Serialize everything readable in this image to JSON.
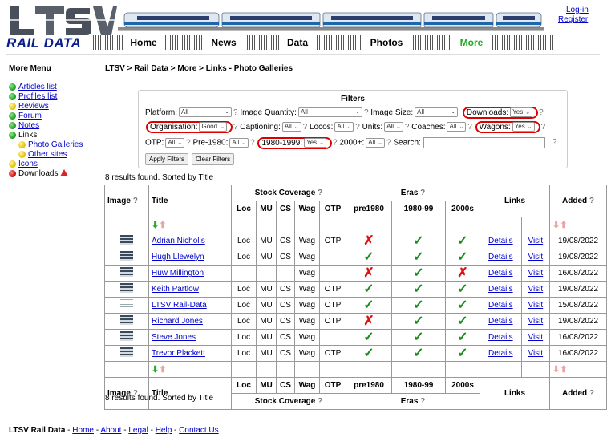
{
  "header": {
    "logo_text": "LTSV",
    "subtitle": "RAIL DATA",
    "nav": [
      "Home",
      "News",
      "Data",
      "Photos",
      "More"
    ],
    "active_nav": "More",
    "login": "Log-in",
    "register": "Register"
  },
  "sidebar": {
    "title": "More Menu",
    "items": [
      {
        "label": "Articles list",
        "color": "green",
        "link": true
      },
      {
        "label": "Profiles list",
        "color": "green",
        "link": true
      },
      {
        "label": "Reviews",
        "color": "yellow",
        "link": true
      },
      {
        "label": "Forum",
        "color": "green",
        "link": true
      },
      {
        "label": "Notes",
        "color": "green",
        "link": true
      },
      {
        "label": "Links",
        "color": "green",
        "link": false
      },
      {
        "label": "Photo Galleries",
        "color": "yellow",
        "link": true
      },
      {
        "label": "Other sites",
        "color": "yellow",
        "link": true
      },
      {
        "label": "Icons",
        "color": "yellow",
        "link": true
      },
      {
        "label": "Downloads",
        "color": "red",
        "link": false,
        "icon": "warning-icon"
      }
    ]
  },
  "breadcrumb": "LTSV > Rail Data > More > Links - Photo Galleries",
  "filters": {
    "title": "Filters",
    "platform": {
      "label": "Platform:",
      "value": "All"
    },
    "image_quantity": {
      "label": "Image Quantity:",
      "value": "All"
    },
    "image_size": {
      "label": "Image Size:",
      "value": "All"
    },
    "downloads": {
      "label": "Downloads:",
      "value": "Yes"
    },
    "organisation": {
      "label": "Organisation:",
      "value": "Good"
    },
    "captioning": {
      "label": "Captioning:",
      "value": "All"
    },
    "locos": {
      "label": "Locos:",
      "value": "All"
    },
    "units": {
      "label": "Units:",
      "value": "All"
    },
    "coaches": {
      "label": "Coaches:",
      "value": "All"
    },
    "wagons": {
      "label": "Wagons:",
      "value": "Yes"
    },
    "otp": {
      "label": "OTP:",
      "value": "All"
    },
    "pre1980": {
      "label": "Pre-1980:",
      "value": "All"
    },
    "y1980_1999": {
      "label": "1980-1999:",
      "value": "Yes"
    },
    "y2000": {
      "label": "2000+:",
      "value": "All"
    },
    "search": {
      "label": "Search:",
      "value": ""
    },
    "help": "?",
    "apply_label": "Apply Filters",
    "clear_label": "Clear Filters"
  },
  "results_text": "8 results found. Sorted by Title",
  "table": {
    "headers": {
      "image": "Image",
      "title": "Title",
      "stock": "Stock Coverage",
      "eras": "Eras",
      "links": "Links",
      "added": "Added",
      "help": "?",
      "sub": [
        "Loc",
        "MU",
        "CS",
        "Wag",
        "OTP",
        "pre1980",
        "1980-99",
        "2000s"
      ]
    },
    "rows": [
      {
        "title": "Adrian Nicholls",
        "loc": "Loc",
        "mu": "MU",
        "cs": "CS",
        "wag": "Wag",
        "otp": "OTP",
        "pre1980": false,
        "y8099": true,
        "y2000": true,
        "details": "Details",
        "visit": "Visit",
        "added": "19/08/2022"
      },
      {
        "title": "Hugh Llewelyn",
        "loc": "Loc",
        "mu": "MU",
        "cs": "CS",
        "wag": "Wag",
        "otp": "",
        "pre1980": true,
        "y8099": true,
        "y2000": true,
        "details": "Details",
        "visit": "Visit",
        "added": "19/08/2022"
      },
      {
        "title": "Huw Millington",
        "loc": "",
        "mu": "",
        "cs": "",
        "wag": "Wag",
        "otp": "",
        "pre1980": false,
        "y8099": true,
        "y2000": false,
        "details": "Details",
        "visit": "Visit",
        "added": "16/08/2022"
      },
      {
        "title": "Keith Partlow",
        "loc": "Loc",
        "mu": "MU",
        "cs": "CS",
        "wag": "Wag",
        "otp": "OTP",
        "pre1980": true,
        "y8099": true,
        "y2000": true,
        "details": "Details",
        "visit": "Visit",
        "added": "19/08/2022"
      },
      {
        "title": "LTSV Rail-Data",
        "loc": "Loc",
        "mu": "MU",
        "cs": "CS",
        "wag": "Wag",
        "otp": "OTP",
        "pre1980": true,
        "y8099": true,
        "y2000": true,
        "details": "Details",
        "visit": "Visit",
        "added": "15/08/2022"
      },
      {
        "title": "Richard Jones",
        "loc": "Loc",
        "mu": "MU",
        "cs": "CS",
        "wag": "Wag",
        "otp": "OTP",
        "pre1980": false,
        "y8099": true,
        "y2000": true,
        "details": "Details",
        "visit": "Visit",
        "added": "19/08/2022"
      },
      {
        "title": "Steve Jones",
        "loc": "Loc",
        "mu": "MU",
        "cs": "CS",
        "wag": "Wag",
        "otp": "",
        "pre1980": true,
        "y8099": true,
        "y2000": true,
        "details": "Details",
        "visit": "Visit",
        "added": "16/08/2022"
      },
      {
        "title": "Trevor Plackett",
        "loc": "Loc",
        "mu": "MU",
        "cs": "CS",
        "wag": "Wag",
        "otp": "OTP",
        "pre1980": true,
        "y8099": true,
        "y2000": true,
        "details": "Details",
        "visit": "Visit",
        "added": "16/08/2022"
      }
    ]
  },
  "footer": {
    "brand": "LTSV Rail Data",
    "links": [
      "Home",
      "About",
      "Legal",
      "Help",
      "Contact Us"
    ],
    "separator": " - "
  },
  "colors": {
    "link": "#0000cc",
    "tick": "#1a8a1a",
    "cross": "#dd1111",
    "circle": "#dd0000",
    "active_nav": "#22aa22"
  }
}
